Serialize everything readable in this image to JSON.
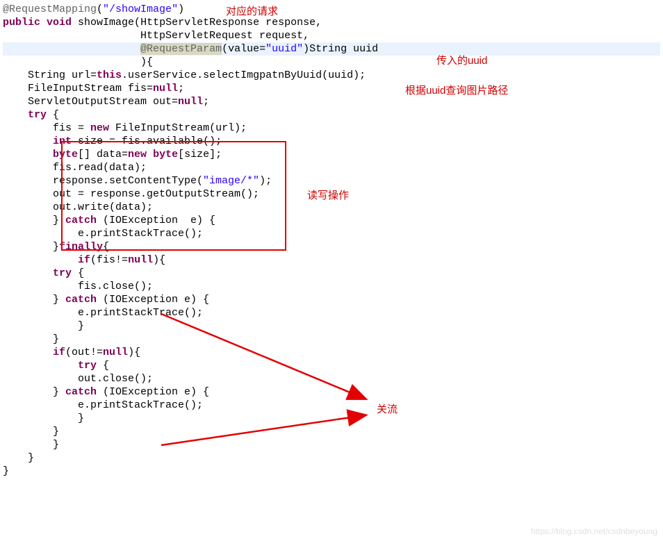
{
  "code": {
    "l1a": "@RequestMapping",
    "l1b": "(",
    "l1c": "\"/showImage\"",
    "l1d": ")",
    "l2a": "public",
    "l2b": " ",
    "l2c": "void",
    "l2d": " showImage(HttpServletResponse response,",
    "l3": "                      HttpServletRequest request,",
    "l4a": "                      ",
    "l4b": "@RequestParam",
    "l4c": "(value=",
    "l4d": "\"uuid\"",
    "l4e": ")String uuid",
    "l5": "                      ){",
    "l6a": "    String url=",
    "l6b": "this",
    "l6c": ".userService.selectImgpatnByUuid(uuid);",
    "l7a": "    FileInputStream fis=",
    "l7b": "null",
    "l7c": ";",
    "l8a": "    ServletOutputStream out=",
    "l8b": "null",
    "l8c": ";",
    "l9a": "    ",
    "l9b": "try",
    "l9c": " {",
    "l10a": "        fis = ",
    "l10b": "new",
    "l10c": " FileInputStream(url);",
    "l11a": "        ",
    "l11b": "int",
    "l11c": " size = fis.available();",
    "l12a": "        ",
    "l12b": "byte",
    "l12c": "[] data=",
    "l12d": "new",
    "l12e": " ",
    "l12f": "byte",
    "l12g": "[size];",
    "l13": "        fis.read(data);",
    "l14a": "        response.setContentType(",
    "l14b": "\"image/*\"",
    "l14c": ");",
    "l15": "        out = response.getOutputStream();",
    "l16": "        out.write(data);",
    "l17a": "        } ",
    "l17b": "catch",
    "l17c": " (IOException  e) {",
    "l18": "            e.printStackTrace();",
    "l19a": "        }",
    "l19b": "finally",
    "l19c": "{",
    "l20a": "            ",
    "l20b": "if",
    "l20c": "(fis!=",
    "l20d": "null",
    "l20e": "){",
    "l21a": "        ",
    "l21b": "try",
    "l21c": " {",
    "l22": "            fis.close();",
    "l23a": "        } ",
    "l23b": "catch",
    "l23c": " (IOException e) {",
    "l24": "            e.printStackTrace();",
    "l25": "            }",
    "l26": "        }",
    "l27a": "        ",
    "l27b": "if",
    "l27c": "(out!=",
    "l27d": "null",
    "l27e": "){",
    "l28a": "            ",
    "l28b": "try",
    "l28c": " {",
    "l29": "            out.close();",
    "l30a": "        } ",
    "l30b": "catch",
    "l30c": " (IOException e) {",
    "l31": "            e.printStackTrace();",
    "l32": "            }",
    "l33": "        }",
    "l34": "        }",
    "l35": "    }",
    "l36": "}"
  },
  "annotations": {
    "a1": "对应的请求",
    "a2": "传入的uuid",
    "a3": "根据uuid查询图片路径",
    "a4": "读写操作",
    "a5": "关流"
  },
  "watermark": "https://blog.csdn.net/csdnbeyoung"
}
